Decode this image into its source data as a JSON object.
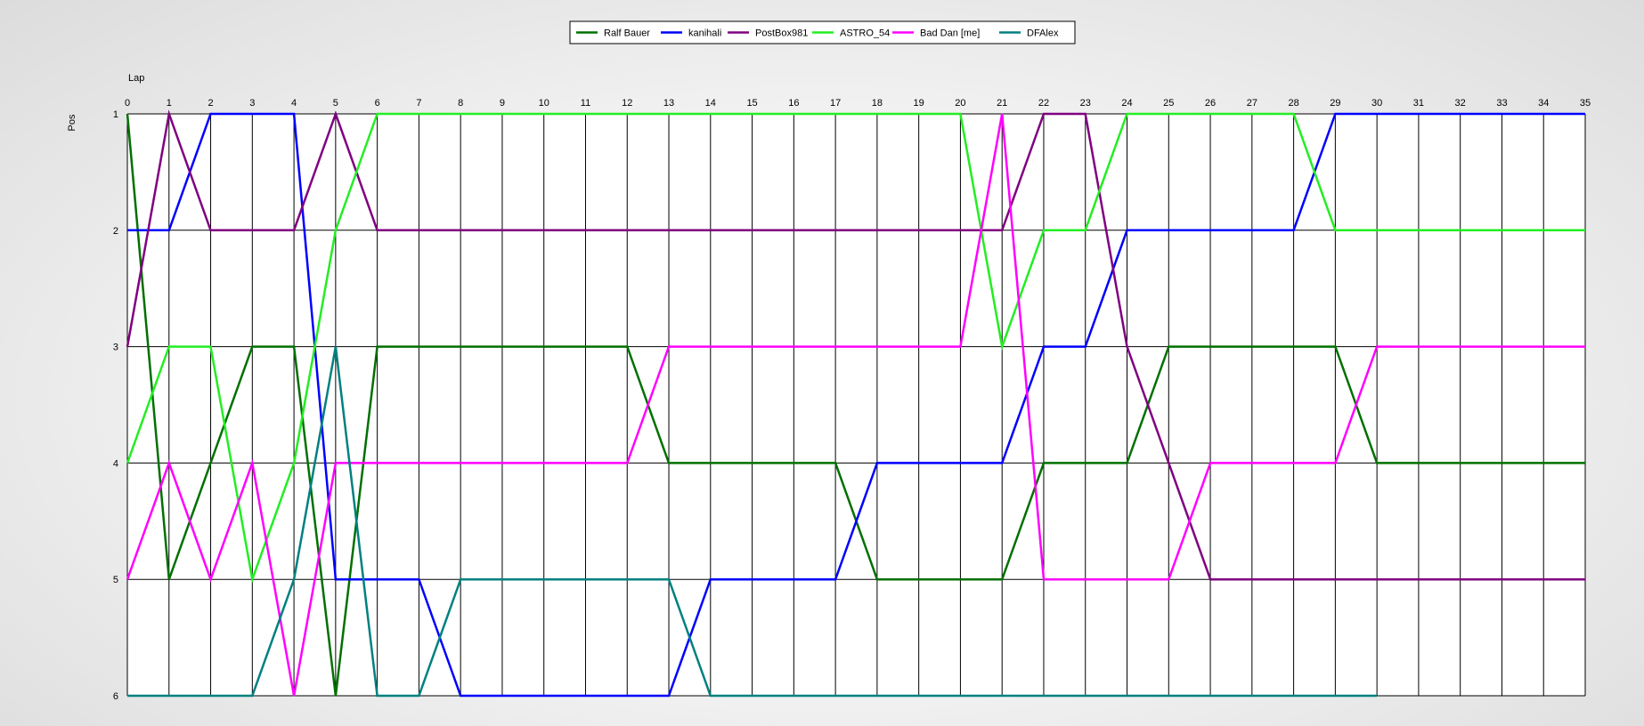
{
  "chart_data": {
    "type": "line",
    "xlabel": "Lap",
    "ylabel": "Pos",
    "xlim": [
      0,
      35
    ],
    "ylim": [
      1,
      6
    ],
    "y_inverted": true,
    "grid": "on",
    "legend_position": "top-center",
    "x": [
      0,
      1,
      2,
      3,
      4,
      5,
      6,
      7,
      8,
      9,
      10,
      11,
      12,
      13,
      14,
      15,
      16,
      17,
      18,
      19,
      20,
      21,
      22,
      23,
      24,
      25,
      26,
      27,
      28,
      29,
      30,
      31,
      32,
      33,
      34,
      35
    ],
    "x_ticks": [
      "0",
      "1",
      "2",
      "3",
      "4",
      "5",
      "6",
      "7",
      "8",
      "9",
      "10",
      "11",
      "12",
      "13",
      "14",
      "15",
      "16",
      "17",
      "18",
      "19",
      "20",
      "21",
      "22",
      "23",
      "24",
      "25",
      "26",
      "27",
      "28",
      "29",
      "30",
      "31",
      "32",
      "33",
      "34",
      "35"
    ],
    "y_ticks": [
      "1",
      "2",
      "3",
      "4",
      "5",
      "6"
    ],
    "series": [
      {
        "name": "Ralf Bauer",
        "color": "#007000",
        "values": [
          1,
          5,
          4,
          3,
          3,
          6,
          3,
          3,
          3,
          3,
          3,
          3,
          3,
          4,
          4,
          4,
          4,
          4,
          5,
          5,
          5,
          5,
          4,
          4,
          4,
          3,
          3,
          3,
          3,
          3,
          4,
          4,
          4,
          4,
          4,
          4
        ]
      },
      {
        "name": "kanihali",
        "color": "#0000ff",
        "values": [
          2,
          2,
          1,
          1,
          1,
          5,
          5,
          5,
          6,
          6,
          6,
          6,
          6,
          6,
          5,
          5,
          5,
          5,
          4,
          4,
          4,
          4,
          3,
          3,
          2,
          2,
          2,
          2,
          2,
          1,
          1,
          1,
          1,
          1,
          1,
          1
        ]
      },
      {
        "name": "PostBox981",
        "color": "#800080",
        "values": [
          3,
          1,
          2,
          2,
          2,
          1,
          2,
          2,
          2,
          2,
          2,
          2,
          2,
          2,
          2,
          2,
          2,
          2,
          2,
          2,
          2,
          2,
          1,
          1,
          3,
          4,
          5,
          5,
          5,
          5,
          5,
          5,
          5,
          5,
          5,
          5
        ]
      },
      {
        "name": "ASTRO_54",
        "color": "#22ee22",
        "values": [
          4,
          3,
          3,
          5,
          4,
          2,
          1,
          1,
          1,
          1,
          1,
          1,
          1,
          1,
          1,
          1,
          1,
          1,
          1,
          1,
          1,
          3,
          2,
          2,
          1,
          1,
          1,
          1,
          1,
          2,
          2,
          2,
          2,
          2,
          2,
          2
        ]
      },
      {
        "name": "Bad Dan [me]",
        "color": "#ff00ff",
        "values": [
          5,
          4,
          5,
          4,
          6,
          4,
          4,
          4,
          4,
          4,
          4,
          4,
          4,
          3,
          3,
          3,
          3,
          3,
          3,
          3,
          3,
          1,
          5,
          5,
          5,
          5,
          4,
          4,
          4,
          4,
          3,
          3,
          3,
          3,
          3,
          3
        ]
      },
      {
        "name": "DFAlex",
        "color": "#008080",
        "values": [
          6,
          6,
          6,
          6,
          5,
          3,
          6,
          6,
          5,
          5,
          5,
          5,
          5,
          5,
          6,
          6,
          6,
          6,
          6,
          6,
          6,
          6,
          6,
          6,
          6,
          6,
          6,
          6,
          6,
          6,
          6
        ]
      }
    ]
  }
}
